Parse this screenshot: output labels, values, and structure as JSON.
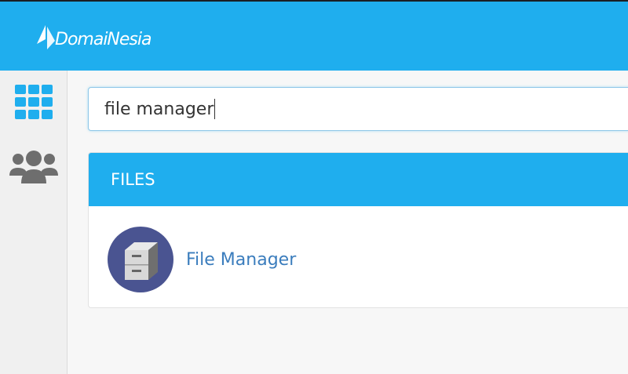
{
  "header": {
    "brand": "DomaiNesia"
  },
  "sidebar": {
    "items": [
      {
        "icon": "grid-icon"
      },
      {
        "icon": "users-icon"
      }
    ]
  },
  "search": {
    "value": "file manager"
  },
  "results": {
    "section_title": "FILES",
    "items": [
      {
        "label": "File Manager",
        "icon": "file-cabinet-icon"
      }
    ]
  },
  "colors": {
    "accent": "#1faeee",
    "link": "#3b7dbd",
    "icon_bg": "#4a5491"
  }
}
